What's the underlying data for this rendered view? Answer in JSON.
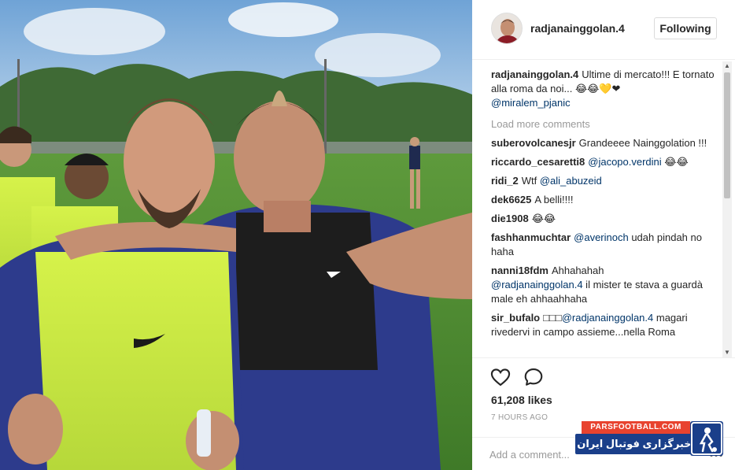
{
  "post": {
    "image_alt": "Two football players posing on a training pitch"
  },
  "header": {
    "username": "radjanainggolan.4",
    "follow_label": "Following"
  },
  "comments": [
    {
      "user": "radjanainggolan.4",
      "text": "Ultime di mercato!!! E tornato alla roma da noi... 😂😂💛❤",
      "mention": "@miralem_pjanic",
      "after": ""
    },
    {
      "type": "load_more",
      "label": "Load more comments"
    },
    {
      "user": "suberovolcanesjr",
      "text": "Grandeeee Nainggolation !!!",
      "mention": "",
      "after": ""
    },
    {
      "user": "riccardo_cesaretti8",
      "text": "",
      "mention": "@jacopo.verdini",
      "after": " 😂😂"
    },
    {
      "user": "ridi_2",
      "text": "Wtf",
      "mention": "@ali_abuzeid",
      "after": ""
    },
    {
      "user": "dek6625",
      "text": "A belli!!!!",
      "mention": "",
      "after": ""
    },
    {
      "user": "die1908",
      "text": "😂😂",
      "mention": "",
      "after": ""
    },
    {
      "user": "fashhanmuchtar",
      "text": "",
      "mention": "@averinoch",
      "after": " udah pindah no haha"
    },
    {
      "user": "nanni18fdm",
      "text": "Ahhahahah",
      "mention": "@radjanainggolan.4",
      "after": " il mister te stava a guardà male eh ahhaahhaha"
    },
    {
      "user": "sir_bufalo",
      "text": "□□□",
      "mention": "@radjanainggolan.4",
      "after": " magari rivedervi in campo assieme...nella Roma"
    }
  ],
  "actions": {
    "likes": "61,208 likes",
    "time": "7 HOURS AGO",
    "comment_placeholder": "Add a comment..."
  },
  "watermark": {
    "top": "PARSFOOTBALL.COM",
    "bottom": "خبرگزاری فوتبال ایران"
  },
  "icons": {
    "like": "heart-icon",
    "comment": "speech-bubble-icon",
    "more": "ellipsis-icon",
    "scroll_up": "scroll-up-arrow-icon",
    "scroll_down": "scroll-down-arrow-icon"
  },
  "colors": {
    "mention": "#003569",
    "muted": "#999999",
    "text": "#262626",
    "border": "#efefef"
  }
}
